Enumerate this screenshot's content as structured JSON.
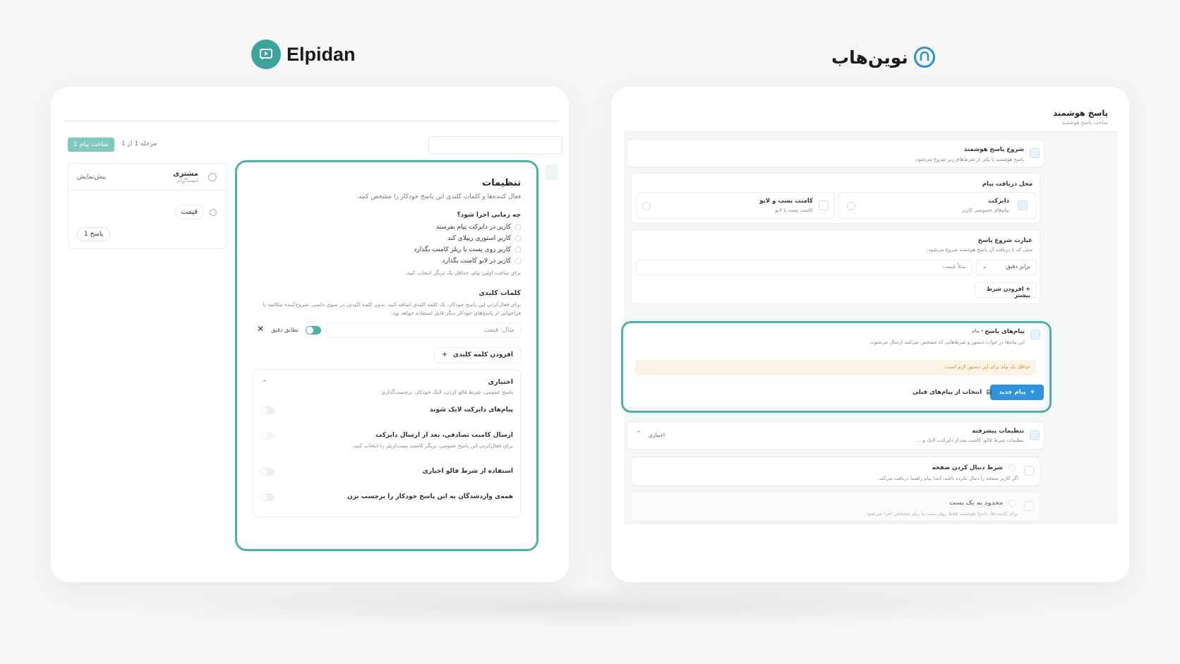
{
  "logos": {
    "left": "Elpidan",
    "right": "نوین‌هاب"
  },
  "left_app": {
    "build_button": "ساخت پیام 1",
    "step": "مرحله 1 از 1",
    "flow": {
      "preview": "پیش‌نمایش",
      "customer": "مشتری",
      "customer_sub": "اینستاگرام",
      "price_chip": "قیمت",
      "reply_chip": "پاسخ 1"
    },
    "settings": {
      "title": "تنظیمات",
      "subtitle": "فعال کننده‌ها و کلمات کلیدی این پاسخ خودکار را مشخص کنید.",
      "when_question": "چه زمانی اجرا شود؟",
      "triggers": [
        "کاربر در دایرکت پیام بفرستد",
        "کاربر استوری ریپلای کند",
        "کاربر روی پست یا ریلز کامنت بگذارد",
        "کاربر در لایو کامنت بگذارد"
      ],
      "trigger_hint": "برای ساخت اولین پیام، حداقل یک تریگر انتخاب کنید.",
      "keywords_title": "کلمات کلیدی",
      "keywords_desc": "برای فعال‌کردن این پاسخ خودکار، یک کلمه کلیدی اضافه کنید. بدون کلمه کلیدی، در منوی دائمی، شروع‌کننده مکالمه یا فراخوانی از پاسخ‌های خودکار دیگر قابل استفاده خواهد بود.",
      "keyword_placeholder": "مثال: قیمت",
      "exact_match": "تطابق دقیق",
      "add_keyword": "افزودن کلمه کلیدی",
      "optional": {
        "title": "اختیاری",
        "subtitle": "پاسخ عمومی، شرط فالو کردن، لایک خودکار، برچسب‌گذاری",
        "items": [
          "پیام‌های دایرکت لایک شوند",
          "ارسال کامنت تصادفی، بعد از ارسال دایرکت",
          "استفاده از شرط فالو اجباری",
          "همه‌ی واردشدگان به این پاسخ خودکار را برچسب بزن"
        ],
        "item2_sub": "برای فعال‌کردن این پاسخ عمومی، تریگر کامنت پست/ریلز را انتخاب کنید."
      }
    }
  },
  "right_app": {
    "title": "پاسخ هوشمند",
    "subtitle": "ساخت پاسخ هوشمند",
    "start": {
      "title": "شروع پاسخ هوشمند",
      "desc": "پاسخ هوشمند با یکی از شرط‌های زیر شروع می‌شود."
    },
    "receive": {
      "title": "محل دریافت پیام",
      "direct": "دایرکت",
      "direct_sub": "پیام‌های خصوصی کاربر",
      "comment": "کامنت پست و لایو",
      "comment_sub": "کامنت پست یا لایو"
    },
    "phrase": {
      "title": "عبارت شروع پاسخ",
      "desc": "متنی که با دریافت آن پاسخ هوشمند شروع می‌شود.",
      "match": "برابر دقیق",
      "placeholder": "مثلاً قیمت",
      "add_more": "افزودن شرط بیشتر"
    },
    "messages": {
      "title": "پیام‌های پاسخ",
      "badge": "• پیام",
      "desc": "این پیام‌ها در جواب دستور و شرط‌هایی که مشخص می‌کنید ارسال می‌شوند.",
      "warning": "حداقل یک پیام برای این دستور لازم است.",
      "new": "پیام جدید",
      "from_previous": "انتخاب از پیام‌های قبلی"
    },
    "advanced": {
      "title": "تنظیمات پیشرفته",
      "desc": "تنظیمات شرط فالو، کامنت بعد از دایرکت، لایک و ...",
      "optional": "اختیاری",
      "follow": "شرط دنبال کردن صفحه",
      "follow_desc": "اگر کاربر صفحه را دنبال نکرده باشد، ابتدا پیام راهنما دریافت می‌کند.",
      "limit": "محدود به یک پست",
      "limit_desc": "برای کامنت‌ها، پاسخ هوشمند فقط روی پست یا ریلز مشخص اجرا می‌شود."
    }
  }
}
